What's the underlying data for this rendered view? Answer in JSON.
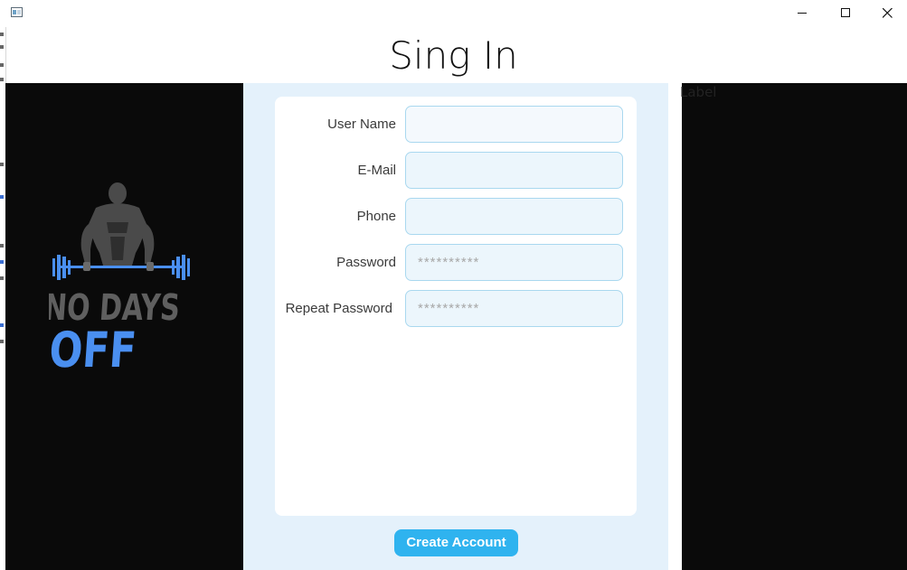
{
  "window": {
    "title": "",
    "controls": {
      "minimize_icon": "minimize-icon",
      "maximize_icon": "maximize-icon",
      "close_icon": "close-icon"
    }
  },
  "page": {
    "title": "Sing In"
  },
  "background_label": "Label",
  "logo": {
    "line1": "NO DAYS",
    "line2": "OFF",
    "colors": {
      "text_gray": "#5f5f5f",
      "text_blue": "#4a8ff0",
      "figure": "#4a4a4a",
      "barbell": "#4a8ff0"
    }
  },
  "form": {
    "fields": [
      {
        "label": "User Name",
        "value": "",
        "placeholder": ""
      },
      {
        "label": "E-Mail",
        "value": "",
        "placeholder": ""
      },
      {
        "label": "Phone",
        "value": "",
        "placeholder": ""
      },
      {
        "label": "Password",
        "value": "",
        "placeholder": "**********"
      },
      {
        "label": "Repeat Password",
        "value": "",
        "placeholder": "**********"
      }
    ],
    "submit_label": "Create Account"
  },
  "colors": {
    "side_panel": "#0a0a0a",
    "center_panel": "#e4f1fb",
    "card": "#ffffff",
    "input_border": "#a9d8ef",
    "input_fill": "#ecf6fc",
    "button": "#2fb3ef"
  }
}
